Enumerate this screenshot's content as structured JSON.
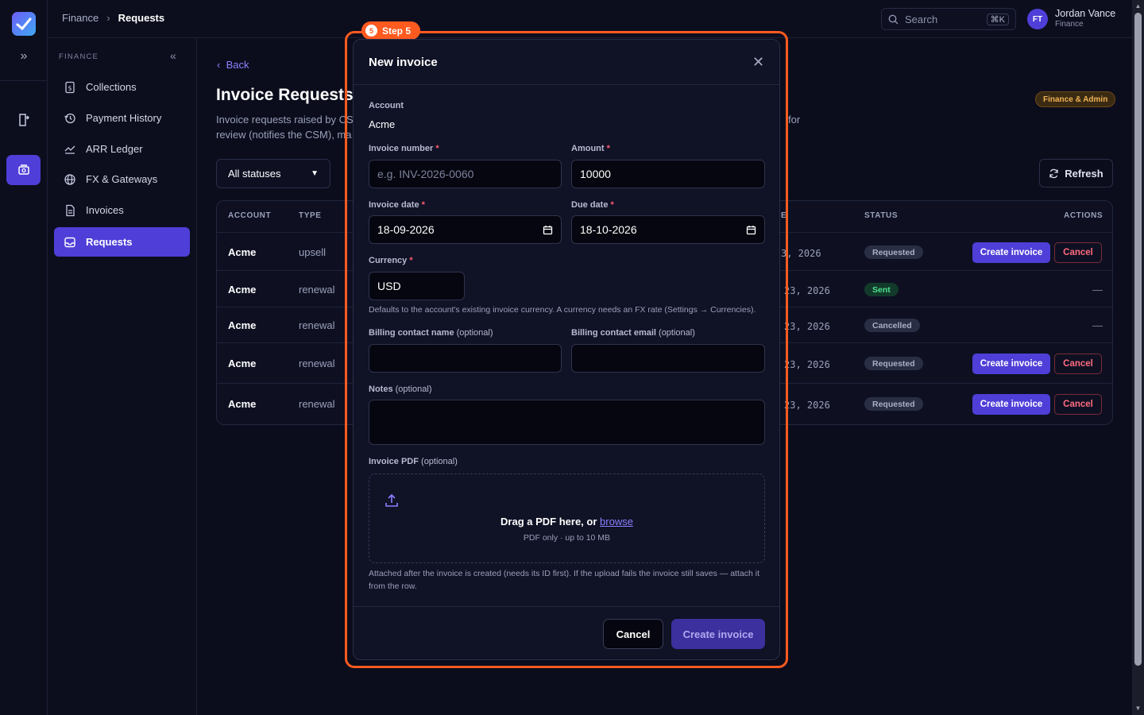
{
  "breadcrumb": {
    "parent": "Finance",
    "current": "Requests"
  },
  "search": {
    "placeholder": "Search",
    "shortcut": "⌘K"
  },
  "user": {
    "initials": "FT",
    "name": "Jordan Vance",
    "role": "Finance"
  },
  "sidebar": {
    "section": "FINANCE",
    "items": [
      {
        "label": "Collections",
        "icon": "dollar-doc-icon"
      },
      {
        "label": "Payment History",
        "icon": "history-icon"
      },
      {
        "label": "ARR Ledger",
        "icon": "chart-line-icon"
      },
      {
        "label": "FX & Gateways",
        "icon": "globe-icon"
      },
      {
        "label": "Invoices",
        "icon": "document-icon"
      },
      {
        "label": "Requests",
        "icon": "inbox-icon",
        "active": true
      }
    ]
  },
  "main": {
    "back": "Back",
    "title": "Invoice Requests",
    "description_line1_left": "Invoice requests raised by CS",
    "description_line1_right": "for",
    "description_line2": "review (notifies the CSM), ma",
    "role_badge": "Finance & Admin",
    "status_filter": "All statuses",
    "refresh": "Refresh"
  },
  "table": {
    "headers": {
      "account": "ACCOUNT",
      "type": "TYPE",
      "date_fragment": "E",
      "status": "STATUS",
      "actions": "ACTIONS"
    },
    "rows": [
      {
        "account": "Acme",
        "type": "upsell",
        "date": "3, 2026",
        "status": "Requested",
        "actions": true
      },
      {
        "account": "Acme",
        "type": "renewal",
        "date": "23, 2026",
        "status": "Sent",
        "actions": false
      },
      {
        "account": "Acme",
        "type": "renewal",
        "date": "23, 2026",
        "status": "Cancelled",
        "actions": false
      },
      {
        "account": "Acme",
        "type": "renewal",
        "date": "23, 2026",
        "status": "Requested",
        "actions": true
      },
      {
        "account": "Acme",
        "type": "renewal",
        "date": "23, 2026",
        "status": "Requested",
        "actions": true
      }
    ],
    "create_label": "Create invoice",
    "cancel_label": "Cancel",
    "empty_action": "—"
  },
  "step": {
    "number": "5",
    "label": "Step 5"
  },
  "modal": {
    "title": "New invoice",
    "account_label": "Account",
    "account_value": "Acme",
    "invoice_number_label": "Invoice number",
    "invoice_number_placeholder": "e.g. INV-2026-0060",
    "amount_label": "Amount",
    "amount_value": "10000",
    "invoice_date_label": "Invoice date",
    "invoice_date_value": "18-09-2026",
    "due_date_label": "Due date",
    "due_date_value": "18-10-2026",
    "currency_label": "Currency",
    "currency_value": "USD",
    "currency_hint": "Defaults to the account's existing invoice currency. A currency needs an FX rate (Settings → Currencies).",
    "billing_name_label": "Billing contact name",
    "billing_email_label": "Billing contact email",
    "optional": "(optional)",
    "notes_label": "Notes",
    "pdf_label": "Invoice PDF",
    "drop_text": "Drag a PDF here, or",
    "drop_link": "browse",
    "drop_sub": "PDF only · up to 10 MB",
    "pdf_hint": "Attached after the invoice is created (needs its ID first). If the upload fails the invoice still saves — attach it from the row.",
    "cancel": "Cancel",
    "create": "Create invoice",
    "required_mark": "*"
  }
}
